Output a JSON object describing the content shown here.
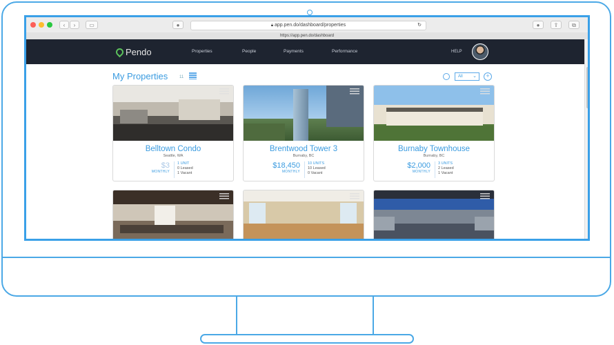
{
  "browser": {
    "url": "app.pen.do/dashboard/properties",
    "tab_url": "https://app.pen.do/dashboard"
  },
  "header": {
    "brand": "Pendo",
    "nav": [
      "Properties",
      "People",
      "Payments",
      "Performance"
    ],
    "help": "HELP"
  },
  "page": {
    "title": "My Properties",
    "count": "11",
    "filter_value": "All"
  },
  "properties": [
    {
      "name": "Belltown Condo",
      "location": "Seattle, WA",
      "price": "$3",
      "per": "MONTHLY",
      "units": "1 UNIT",
      "leased": "0 Leased",
      "vacant": "1 Vacant"
    },
    {
      "name": "Brentwood Tower 3",
      "location": "Burnaby, BC",
      "price": "$18,450",
      "per": "MONTHLY",
      "units": "10 UNITS",
      "leased": "10 Leased",
      "vacant": "0 Vacant"
    },
    {
      "name": "Burnaby Townhouse",
      "location": "Burnaby, BC",
      "price": "$2,000",
      "per": "MONTHLY",
      "units": "3 UNITS",
      "leased": "2 Leased",
      "vacant": "1 Vacant"
    }
  ],
  "colors": {
    "accent": "#3a9be0",
    "header_bg": "#1e2430",
    "frame": "#4aa8e6"
  }
}
